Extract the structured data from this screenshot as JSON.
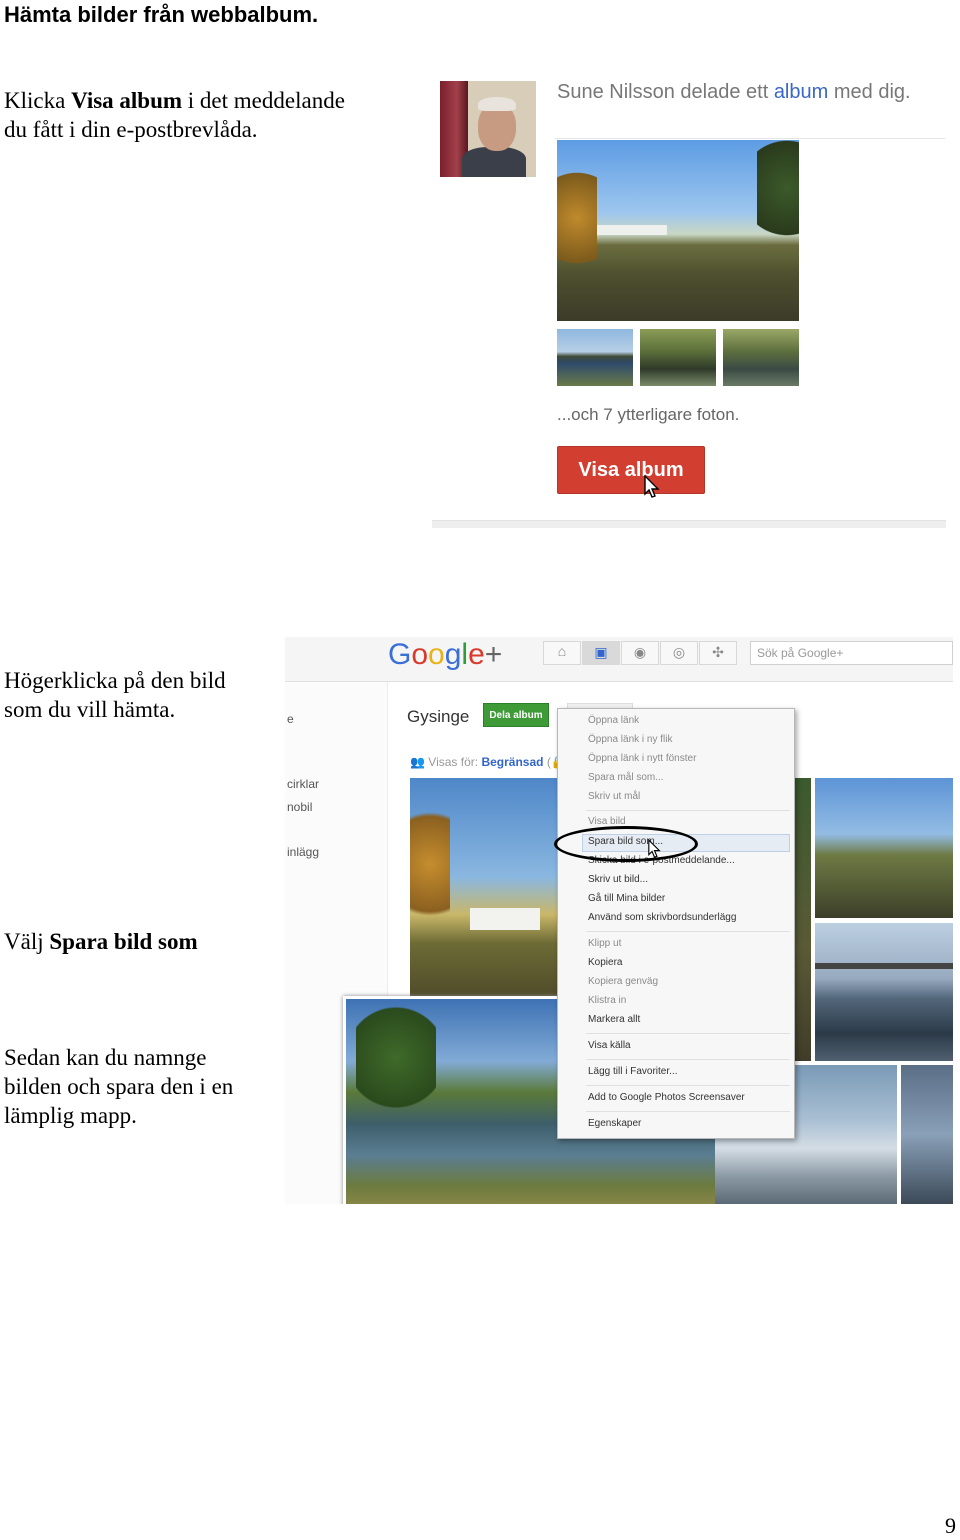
{
  "page": {
    "title": "Hämta bilder från webbalbum.",
    "page_number": "9"
  },
  "instructions": {
    "step1_pre": "Klicka ",
    "step1_bold": "Visa album",
    "step1_post": " i det meddelande",
    "step1_line2": "du fått i din e-postbrevlåda.",
    "step2_line1": "Högerklicka på den bild",
    "step2_line2": "som du vill hämta.",
    "step3_pre": "Välj ",
    "step3_bold": "Spara bild som",
    "step4_line1": "Sedan kan du namnge",
    "step4_line2": "bilden och spara den i en",
    "step4_line3": "lämplig mapp."
  },
  "email": {
    "share_pre": "Sune Nilsson delade ett ",
    "share_link": "album",
    "share_post": " med dig.",
    "more_photos": "...och 7 ytterligare foton.",
    "button_label": "Visa album"
  },
  "gplus": {
    "logo": "Google+",
    "search_placeholder": "Sök på Google+",
    "left_items": [
      "e",
      "cirklar",
      "nobil",
      "inlägg"
    ],
    "album_title": "Gysinge",
    "share_button": "Dela album",
    "visible_for_label": "Visas för: ",
    "visible_for_value": "Begränsad",
    "nav_icons": [
      "home-icon",
      "photos-icon",
      "profile-icon",
      "circles-icon",
      "games-icon"
    ]
  },
  "context_menu": {
    "items": [
      {
        "label": "Öppna länk",
        "enabled": false
      },
      {
        "label": "Öppna länk i ny flik",
        "enabled": false
      },
      {
        "label": "Öppna länk i nytt fönster",
        "enabled": false
      },
      {
        "label": "Spara mål som...",
        "enabled": false
      },
      {
        "label": "Skriv ut mål",
        "enabled": false
      },
      {
        "label": "Visa bild",
        "enabled": false
      },
      {
        "label": "Spara bild som...",
        "enabled": true,
        "highlighted": true
      },
      {
        "label": "Skicka bild i e-postmeddelande...",
        "enabled": true
      },
      {
        "label": "Skriv ut bild...",
        "enabled": true
      },
      {
        "label": "Gå till Mina bilder",
        "enabled": true
      },
      {
        "label": "Använd som skrivbordsunderlägg",
        "enabled": true
      },
      {
        "label": "Klipp ut",
        "enabled": false
      },
      {
        "label": "Kopiera",
        "enabled": true
      },
      {
        "label": "Kopiera genväg",
        "enabled": false
      },
      {
        "label": "Klistra in",
        "enabled": false
      },
      {
        "label": "Markera allt",
        "enabled": true
      },
      {
        "label": "Visa källa",
        "enabled": true
      },
      {
        "label": "Lägg till i Favoriter...",
        "enabled": true
      },
      {
        "label": "Add to Google Photos Screensaver",
        "enabled": true
      },
      {
        "label": "Egenskaper",
        "enabled": true
      }
    ]
  },
  "colors": {
    "visa_button": "#d23f31",
    "dela_button": "#3d9a36",
    "link_blue": "#3366cc"
  }
}
